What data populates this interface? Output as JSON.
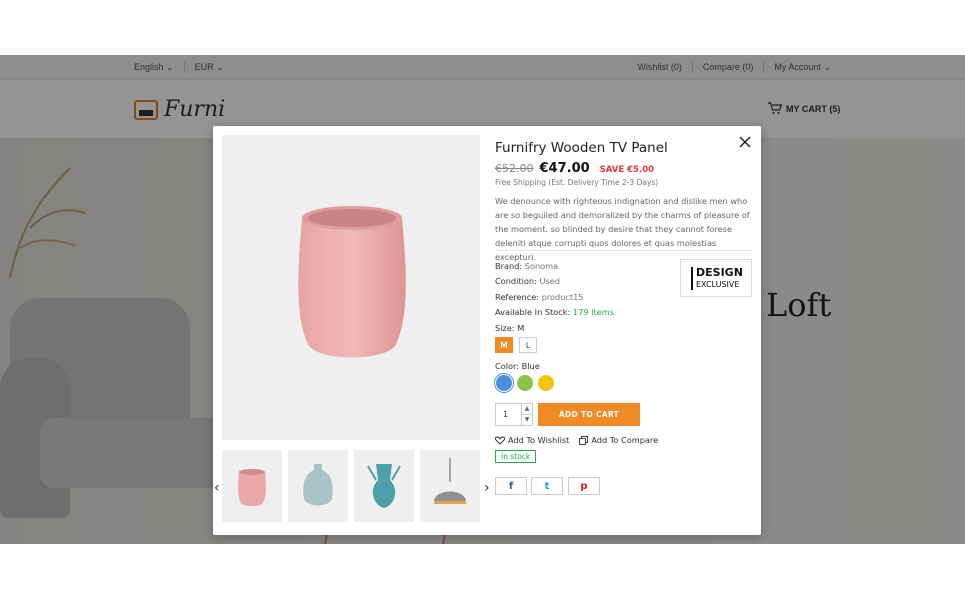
{
  "topbar": {
    "language": "English",
    "currency": "EUR",
    "wishlist": "Wishlist (0)",
    "compare": "Compare (0)",
    "account": "My Account"
  },
  "header": {
    "logo_text": "Furni",
    "cart": "MY CART (5)"
  },
  "hero": {
    "heading": "Loft"
  },
  "modal": {
    "title": "Furnifry Wooden TV Panel",
    "old_price": "€52.00",
    "new_price": "€47.00",
    "save": "SAVE €5.00",
    "shipping": "Free Shipping (Est. Delivery Time 2-3 Days)",
    "description": "We denounce with righteous indignation and dislike men who are so beguiled and demoralized by the charms of pleasure of the moment. so blinded by desire that they cannot forese deleniti atque corrupti quos dolores et quas molestias excepturi.",
    "brand_label": "Brand:",
    "brand_value": "Sonoma",
    "condition_label": "Condition:",
    "condition_value": "Used",
    "reference_label": "Reference:",
    "reference_value": "product15",
    "stock_label": "Available In Stock:",
    "stock_value": "179 Items",
    "brand_logo_line1": "DESIGN",
    "brand_logo_line2": "EXCLUSIVE",
    "size_label": "Size:",
    "size_value": "M",
    "sizes": [
      "M",
      "L"
    ],
    "color_label": "Color:",
    "color_value": "Blue",
    "colors": [
      "#4a90e2",
      "#8bc34a",
      "#f1c40f"
    ],
    "quantity": "1",
    "add_to_cart": "ADD TO CART",
    "add_to_wishlist": "Add To Wishlist",
    "add_to_compare": "Add To Compare",
    "in_stock": "In stock",
    "share_facebook": "f",
    "share_twitter": "t",
    "share_pinterest": "p"
  },
  "colors": {
    "accent": "#f08a24",
    "sale": "#e53935",
    "stock": "#2eaa45"
  }
}
